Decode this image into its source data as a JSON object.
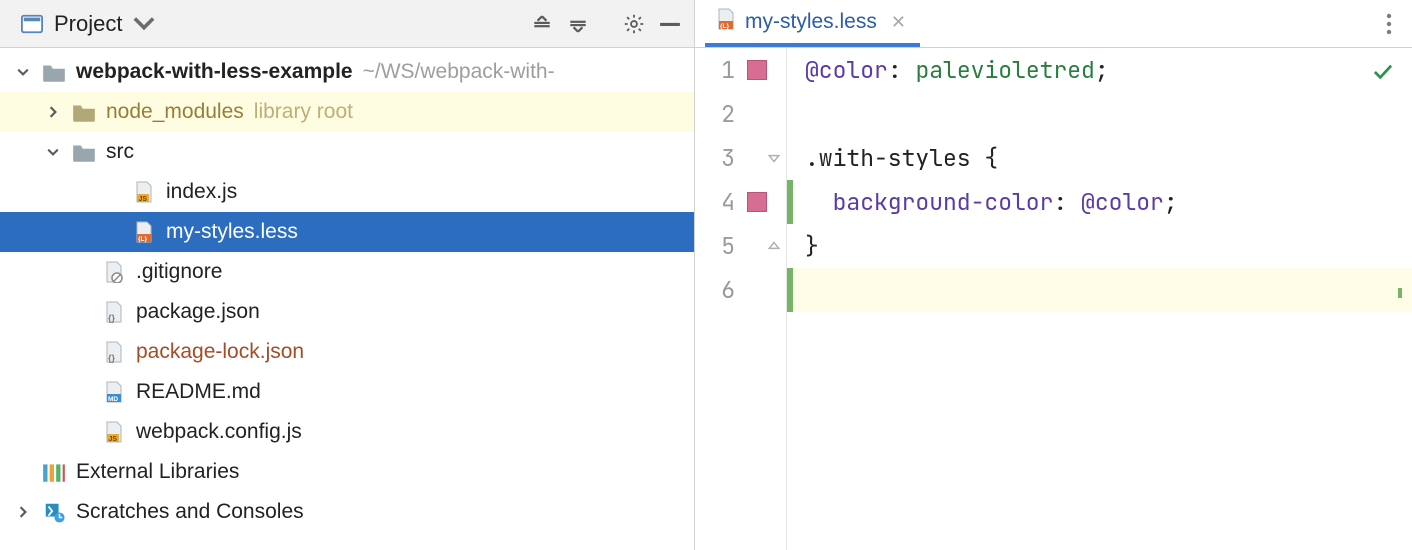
{
  "panel": {
    "title": "Project"
  },
  "tree": {
    "root": {
      "name": "webpack-with-less-example",
      "path": "~/WS/webpack-with-"
    },
    "node_modules": {
      "name": "node_modules",
      "aux": "library root"
    },
    "src": {
      "name": "src"
    },
    "files": {
      "index_js": "index.js",
      "my_styles": "my-styles.less",
      "gitignore": ".gitignore",
      "package_json": "package.json",
      "package_lock": "package-lock.json",
      "readme": "README.md",
      "webpack_cfg": "webpack.config.js"
    },
    "ext_lib": "External Libraries",
    "scratches": "Scratches and Consoles"
  },
  "tab": {
    "label": "my-styles.less"
  },
  "gutter": {
    "l1": "1",
    "l2": "2",
    "l3": "3",
    "l4": "4",
    "l5": "5",
    "l6": "6"
  },
  "code": {
    "l1": {
      "var": "@color",
      "colon": ":",
      "val": "palevioletred",
      "semi": ";"
    },
    "l3": {
      "sel": ".with-styles",
      "brace": "{"
    },
    "l4": {
      "prop": "background-color",
      "colon": ":",
      "val": "@color",
      "semi": ";"
    },
    "l5": {
      "brace": "}"
    }
  },
  "colors": {
    "palevioletred": "#db7093"
  }
}
